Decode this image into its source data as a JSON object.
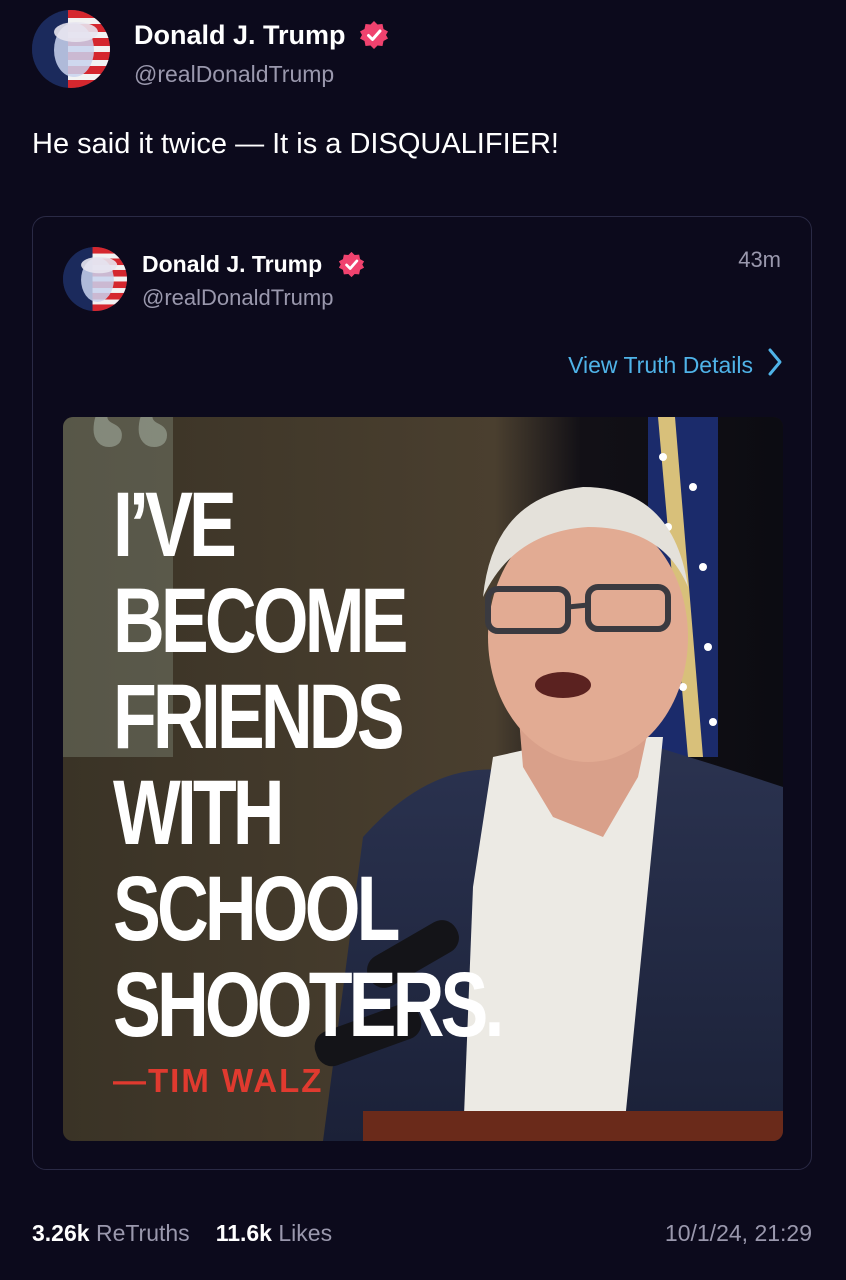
{
  "author": {
    "name": "Donald J. Trump",
    "handle": "@realDonaldTrump",
    "avatar_icon": "flag-portrait-avatar",
    "verified_icon": "verified-badge-icon",
    "verified_color": "#f0426e"
  },
  "post": {
    "text": "He said it twice — It is a DISQUALIFIER!"
  },
  "quoted": {
    "name": "Donald J. Trump",
    "handle": "@realDonaldTrump",
    "time": "43m",
    "details_label": "View Truth Details",
    "details_icon": "chevron-right-icon",
    "link_color": "#4fb3e8",
    "image": {
      "headline": [
        "I’VE",
        "BECOME",
        "FRIENDS",
        "WITH",
        "SCHOOL",
        "SHOOTERS."
      ],
      "attribution": "—TIM WALZ",
      "attribution_color": "#e03a2f"
    }
  },
  "stats": {
    "retruths_count": "3.26k",
    "retruths_label": "ReTruths",
    "likes_count": "11.6k",
    "likes_label": "Likes",
    "date": "10/1/24, 21:29"
  }
}
